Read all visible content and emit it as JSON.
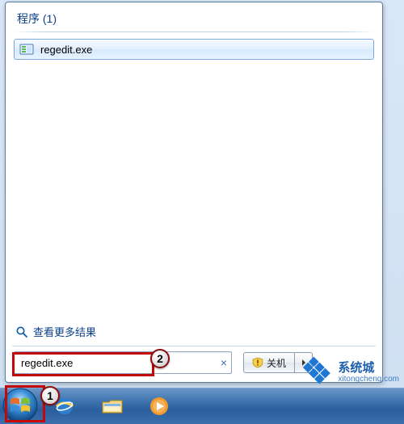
{
  "header": {
    "title": "程序 (1)"
  },
  "results": [
    {
      "label": "regedit.exe",
      "icon": "regedit-icon"
    }
  ],
  "more_results": {
    "label": "查看更多结果"
  },
  "search": {
    "value": "regedit.exe",
    "clear": "×"
  },
  "shutdown": {
    "label": "关机"
  },
  "callouts": {
    "one": "1",
    "two": "2"
  },
  "watermark": {
    "brand": "系统城",
    "url": "xitongcheng.com"
  },
  "colors": {
    "accent": "#0b3f8a",
    "annotation": "#c20808",
    "taskbar": "#2a5e9c"
  }
}
